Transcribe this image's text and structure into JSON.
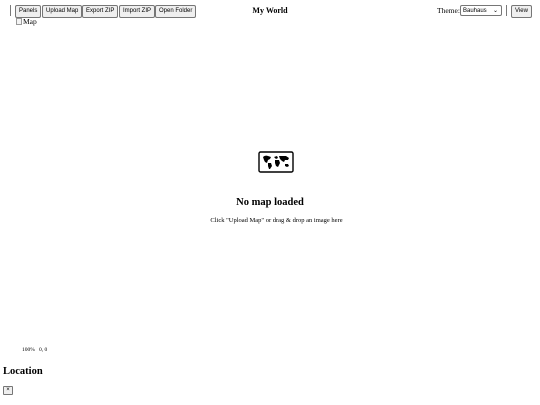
{
  "toolbar": {
    "buttons": {
      "panels": "Panels",
      "upload_map": "Upload Map",
      "export_zip": "Export ZIP",
      "import_zip": "Import ZIP",
      "open_folder": "Open Folder",
      "view": "View"
    },
    "title": "My World",
    "theme_label": "Theme:",
    "theme_selected": "Bauhaus"
  },
  "map": {
    "image_alt": "Map",
    "zoom_text": "100%",
    "coords_text": "0, 0"
  },
  "empty_state": {
    "icon": "world-map-icon",
    "title": "No map loaded",
    "hint": "Click \"Upload Map\" or drag & drop an image here"
  },
  "panel": {
    "title": "Location",
    "close_label": "×"
  }
}
